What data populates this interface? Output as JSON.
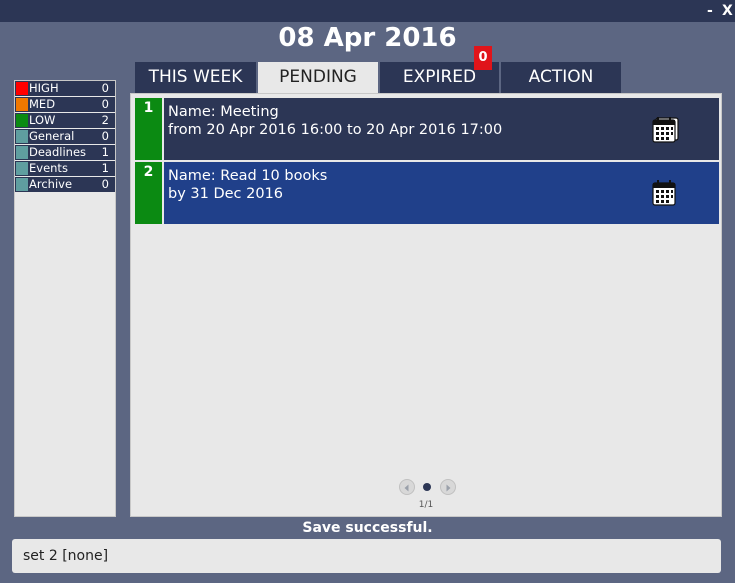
{
  "window": {
    "minimize_label": "-",
    "close_label": "X"
  },
  "header": {
    "date": "08 Apr 2016"
  },
  "sidebar": {
    "categories": [
      {
        "label": "HIGH",
        "count": "0",
        "color": "#ff0000"
      },
      {
        "label": "MED",
        "count": "0",
        "color": "#f07800"
      },
      {
        "label": "LOW",
        "count": "2",
        "color": "#0b8a12"
      },
      {
        "label": "General",
        "count": "0",
        "color": "#5f9ea0"
      },
      {
        "label": "Deadlines",
        "count": "1",
        "color": "#5f9ea0"
      },
      {
        "label": "Events",
        "count": "1",
        "color": "#5f9ea0"
      },
      {
        "label": "Archive",
        "count": "0",
        "color": "#5f9ea0"
      }
    ]
  },
  "tabs": [
    {
      "label": "THIS WEEK"
    },
    {
      "label": "PENDING",
      "active": true
    },
    {
      "label": "EXPIRED",
      "badge": "0"
    },
    {
      "label": "ACTION"
    }
  ],
  "tasks": [
    {
      "index": "1",
      "name": "Name: Meeting",
      "detail": "from 20 Apr 2016 16:00 to 20 Apr 2016 17:00",
      "icon": "calendar-multi-icon",
      "bg": "#2c3655"
    },
    {
      "index": "2",
      "name": "Name: Read 10 books",
      "detail": "by 31 Dec 2016",
      "icon": "calendar-icon",
      "bg": "#20408a"
    }
  ],
  "pager": {
    "page_label": "1/1"
  },
  "status": {
    "message": "Save successful."
  },
  "command": {
    "value": "set 2 [none]"
  },
  "colors": {
    "accent_dark": "#2c3655",
    "background": "#5c6682",
    "badge_red": "#e0141a",
    "low_green": "#0b8a12"
  }
}
